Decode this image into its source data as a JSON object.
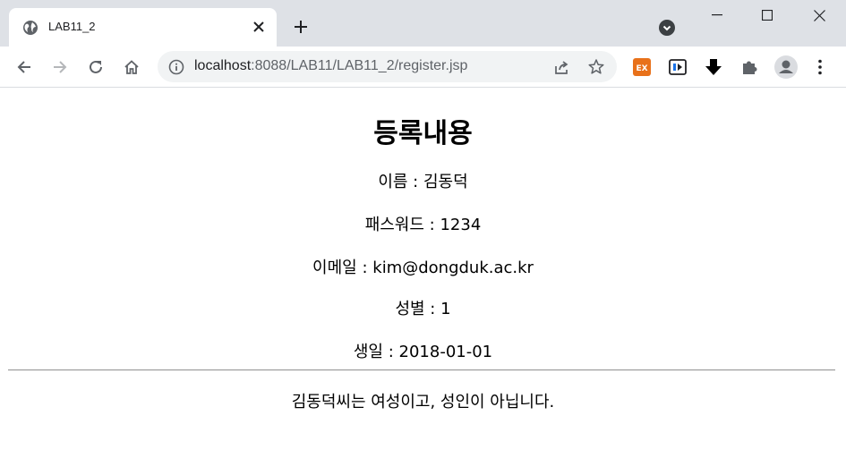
{
  "browser": {
    "tab_title": "LAB11_2",
    "url_host": "localhost",
    "url_rest": ":8088/LAB11/LAB11_2/register.jsp",
    "extensions": [
      "ex-extension-icon",
      "media-extension-icon",
      "download-extension-icon",
      "puzzle-icon"
    ],
    "accent": "#e8711a"
  },
  "page": {
    "heading": "등록내용",
    "fields": [
      {
        "label": "이름",
        "value": "김동덕"
      },
      {
        "label": "패스워드",
        "value": "1234"
      },
      {
        "label": "이메일",
        "value": "kim@dongduk.ac.kr"
      },
      {
        "label": "성별",
        "value": "1"
      },
      {
        "label": "생일",
        "value": "2018-01-01"
      }
    ],
    "separator": ":",
    "summary": "김동덕씨는 여성이고, 성인이 아닙니다."
  }
}
